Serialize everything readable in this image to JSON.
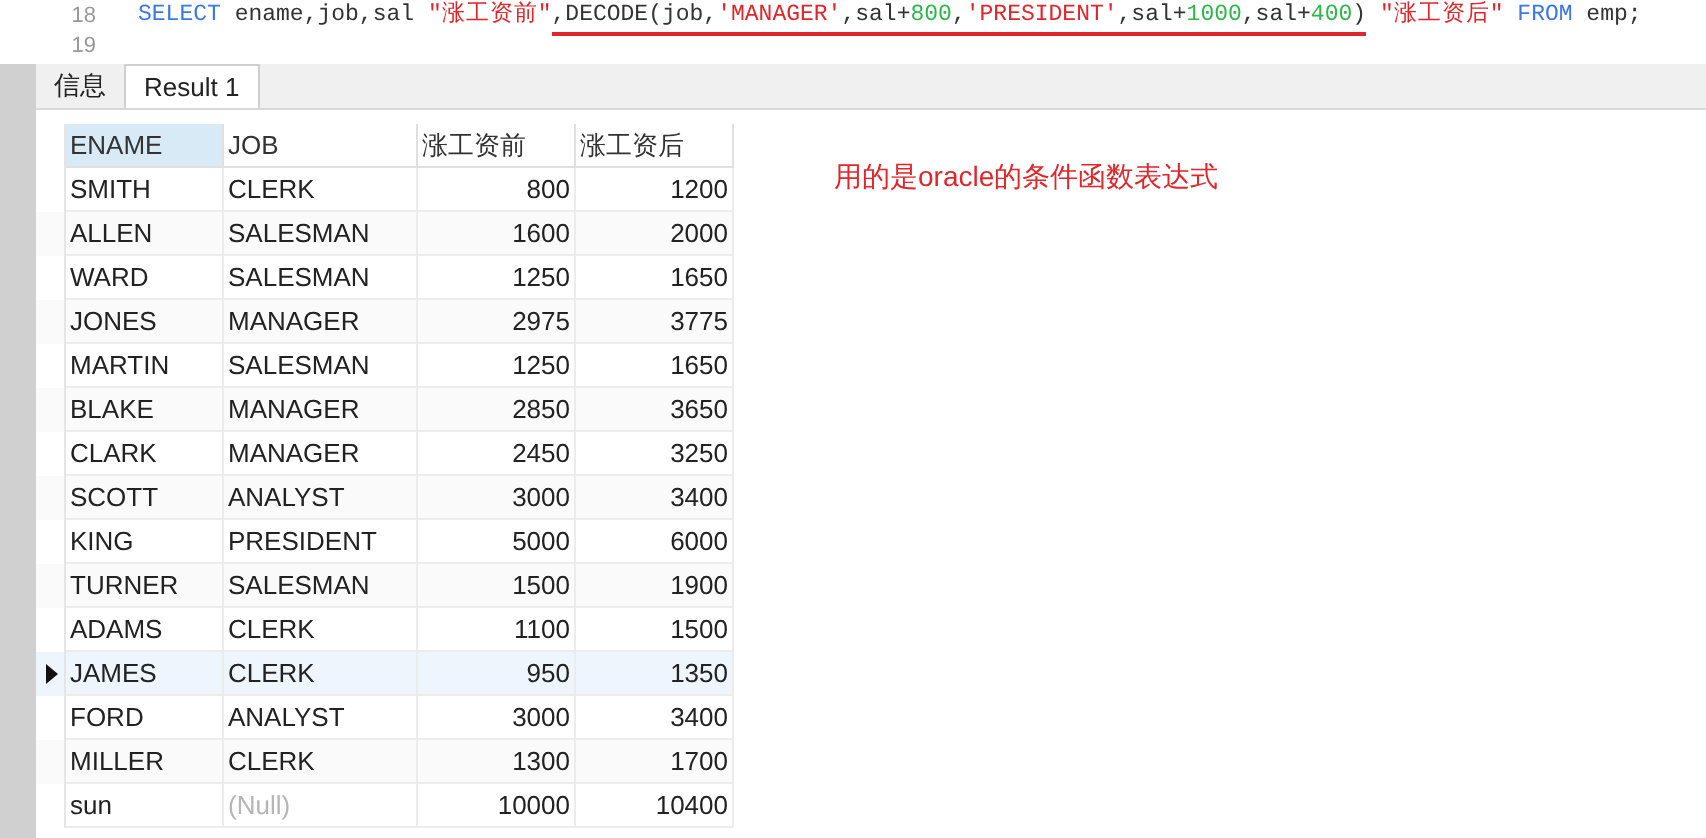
{
  "editor": {
    "lines": [
      {
        "number": "18",
        "segments": [
          {
            "underlined": false,
            "tokens": [
              {
                "text": "SELECT",
                "kind": "keyword"
              },
              {
                "text": " ename,job,sal ",
                "kind": "plain"
              },
              {
                "text": "\"涨工资前\"",
                "kind": "string"
              }
            ]
          },
          {
            "underlined": true,
            "tokens": [
              {
                "text": ",DECODE(job,",
                "kind": "plain"
              },
              {
                "text": "'MANAGER'",
                "kind": "string"
              },
              {
                "text": ",sal+",
                "kind": "plain"
              },
              {
                "text": "800",
                "kind": "number"
              },
              {
                "text": ",",
                "kind": "plain"
              },
              {
                "text": "'PRESIDENT'",
                "kind": "string"
              },
              {
                "text": ",sal+",
                "kind": "plain"
              },
              {
                "text": "1000",
                "kind": "number"
              },
              {
                "text": ",sal+",
                "kind": "plain"
              },
              {
                "text": "400",
                "kind": "number"
              },
              {
                "text": ")",
                "kind": "plain"
              }
            ]
          },
          {
            "underlined": false,
            "tokens": [
              {
                "text": " \"涨工资后\"",
                "kind": "string"
              },
              {
                "text": " FROM",
                "kind": "keyword"
              },
              {
                "text": " emp;",
                "kind": "plain"
              }
            ]
          }
        ]
      },
      {
        "number": "19"
      }
    ]
  },
  "tabs": [
    {
      "label": "信息",
      "selected": false
    },
    {
      "label": "Result 1",
      "selected": true
    }
  ],
  "table": {
    "columns": [
      {
        "label": "ENAME",
        "kind": "text",
        "selected": true
      },
      {
        "label": "JOB",
        "kind": "text",
        "selected": false
      },
      {
        "label": "涨工资前",
        "kind": "number",
        "selected": false
      },
      {
        "label": "涨工资后",
        "kind": "number",
        "selected": false
      }
    ],
    "rows": [
      {
        "cells": [
          "SMITH",
          "CLERK",
          "800",
          "1200"
        ],
        "selected": false
      },
      {
        "cells": [
          "ALLEN",
          "SALESMAN",
          "1600",
          "2000"
        ],
        "selected": false
      },
      {
        "cells": [
          "WARD",
          "SALESMAN",
          "1250",
          "1650"
        ],
        "selected": false
      },
      {
        "cells": [
          "JONES",
          "MANAGER",
          "2975",
          "3775"
        ],
        "selected": false
      },
      {
        "cells": [
          "MARTIN",
          "SALESMAN",
          "1250",
          "1650"
        ],
        "selected": false
      },
      {
        "cells": [
          "BLAKE",
          "MANAGER",
          "2850",
          "3650"
        ],
        "selected": false
      },
      {
        "cells": [
          "CLARK",
          "MANAGER",
          "2450",
          "3250"
        ],
        "selected": false
      },
      {
        "cells": [
          "SCOTT",
          "ANALYST",
          "3000",
          "3400"
        ],
        "selected": false
      },
      {
        "cells": [
          "KING",
          "PRESIDENT",
          "5000",
          "6000"
        ],
        "selected": false
      },
      {
        "cells": [
          "TURNER",
          "SALESMAN",
          "1500",
          "1900"
        ],
        "selected": false
      },
      {
        "cells": [
          "ADAMS",
          "CLERK",
          "1100",
          "1500"
        ],
        "selected": false
      },
      {
        "cells": [
          "JAMES",
          "CLERK",
          "950",
          "1350"
        ],
        "selected": true
      },
      {
        "cells": [
          "FORD",
          "ANALYST",
          "3000",
          "3400"
        ],
        "selected": false
      },
      {
        "cells": [
          "MILLER",
          "CLERK",
          "1300",
          "1700"
        ],
        "selected": false
      },
      {
        "cells": [
          "sun",
          {
            "text": "(Null)",
            "kind": "null"
          },
          "10000",
          "10400"
        ],
        "selected": false
      }
    ]
  },
  "note": "用的是oracle的条件函数表达式"
}
